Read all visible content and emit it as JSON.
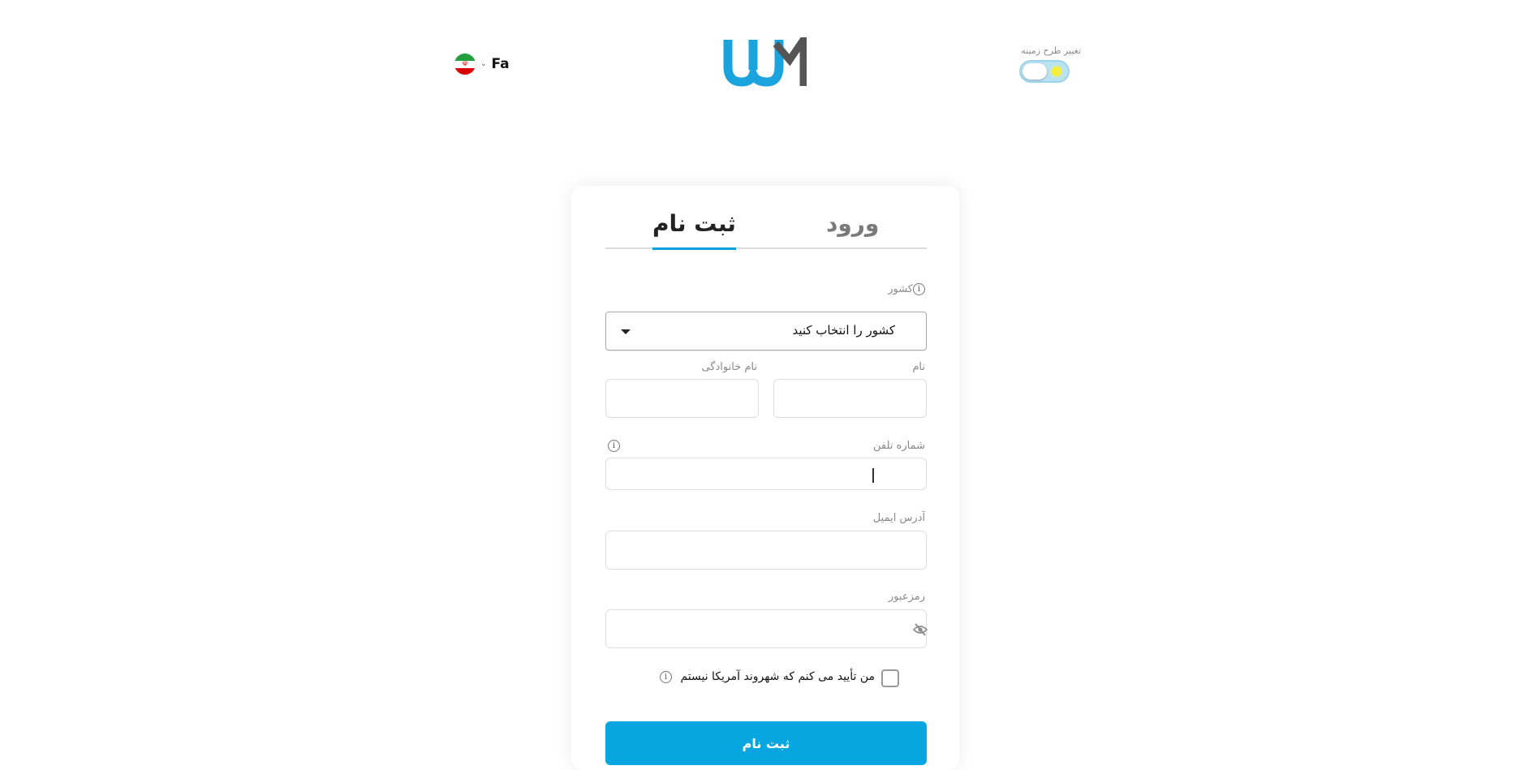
{
  "header": {
    "language_code": "Fa",
    "flag_emblem": "☫",
    "theme_label": "تغییر طرح زمینه"
  },
  "tabs": {
    "login": "ورود",
    "register": "ثبت نام",
    "active": "register"
  },
  "form": {
    "country_label": "کشور",
    "country_value": "کشور را انتخاب کنید",
    "first_name_label": "نام",
    "last_name_label": "نام خانوادگی",
    "phone_label": "شماره تلفن",
    "email_label": "آدرس ایمیل",
    "password_label": "رمزعبور",
    "us_citizen_confirm": "من تأیید می کنم که شهروند آمریکا نیستم",
    "submit_label": "ثبت نام"
  },
  "colors": {
    "accent": "#08a6e0",
    "logo_blue": "#1aa3dc",
    "logo_gray": "#555555"
  },
  "icons": [
    "iran-flag-icon",
    "chevron-down-icon",
    "info-icon",
    "eye-slash-icon",
    "sun-icon"
  ]
}
